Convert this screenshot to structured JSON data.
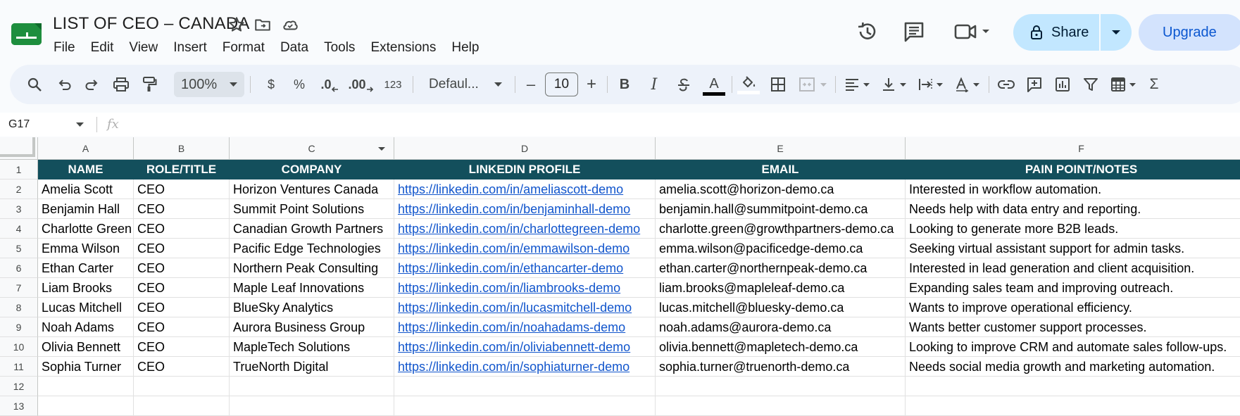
{
  "document": {
    "title": "LIST OF CEO – CANADA"
  },
  "menu": [
    "File",
    "Edit",
    "View",
    "Insert",
    "Format",
    "Data",
    "Tools",
    "Extensions",
    "Help"
  ],
  "header_actions": {
    "share_label": "Share",
    "upgrade_label": "Upgrade"
  },
  "toolbar": {
    "zoom": "100%",
    "currency": "$",
    "percent": "%",
    "decrease_decimal": ".0",
    "increase_decimal": ".00",
    "number_format": "123",
    "font": "Defaul...",
    "font_size": "10",
    "minus": "–",
    "plus": "+",
    "bold": "B",
    "italic": "I",
    "text_color_letter": "A",
    "sum": "Σ"
  },
  "formula_bar": {
    "cell_ref": "G17",
    "fx_label": "fx"
  },
  "columns": [
    "A",
    "B",
    "C",
    "D",
    "E",
    "F"
  ],
  "rows": [
    "1",
    "2",
    "3",
    "4",
    "5",
    "6",
    "7",
    "8",
    "9",
    "10",
    "11",
    "12",
    "13"
  ],
  "headers": [
    "NAME",
    "ROLE/TITLE",
    "COMPANY",
    "LINKEDIN PROFILE",
    "EMAIL",
    "PAIN POINT/NOTES"
  ],
  "records": [
    [
      "Amelia Scott",
      "CEO",
      "Horizon Ventures Canada",
      "https://linkedin.com/in/ameliascott-demo",
      "amelia.scott@horizon-demo.ca",
      "Interested in workflow automation."
    ],
    [
      "Benjamin Hall",
      "CEO",
      "Summit Point Solutions",
      "https://linkedin.com/in/benjaminhall-demo",
      "benjamin.hall@summitpoint-demo.ca",
      "Needs help with data entry and reporting."
    ],
    [
      "Charlotte Green",
      "CEO",
      "Canadian Growth Partners",
      "https://linkedin.com/in/charlottegreen-demo",
      "charlotte.green@growthpartners-demo.ca",
      "Looking to generate more B2B leads."
    ],
    [
      "Emma Wilson",
      "CEO",
      "Pacific Edge Technologies",
      "https://linkedin.com/in/emmawilson-demo",
      "emma.wilson@pacificedge-demo.ca",
      "Seeking virtual assistant support for admin tasks."
    ],
    [
      "Ethan Carter",
      "CEO",
      "Northern Peak Consulting",
      "https://linkedin.com/in/ethancarter-demo",
      "ethan.carter@northernpeak-demo.ca",
      "Interested in lead generation and client acquisition."
    ],
    [
      "Liam Brooks",
      "CEO",
      "Maple Leaf Innovations",
      "https://linkedin.com/in/liambrooks-demo",
      "liam.brooks@mapleleaf-demo.ca",
      "Expanding sales team and improving outreach."
    ],
    [
      "Lucas Mitchell",
      "CEO",
      "BlueSky Analytics",
      "https://linkedin.com/in/lucasmitchell-demo",
      "lucas.mitchell@bluesky-demo.ca",
      "Wants to improve operational efficiency."
    ],
    [
      "Noah Adams",
      "CEO",
      "Aurora Business Group",
      "https://linkedin.com/in/noahadams-demo",
      "noah.adams@aurora-demo.ca",
      "Wants better customer support processes."
    ],
    [
      "Olivia Bennett",
      "CEO",
      "MapleTech Solutions",
      "https://linkedin.com/in/oliviabennett-demo",
      "olivia.bennett@mapletech-demo.ca",
      "Looking to improve CRM and automate sales follow-ups."
    ],
    [
      "Sophia Turner",
      "CEO",
      "TrueNorth Digital",
      "https://linkedin.com/in/sophiaturner-demo",
      "sophia.turner@truenorth-demo.ca",
      "Needs social media growth and marketing automation."
    ]
  ],
  "colors": {
    "header_fill": "#134f5c",
    "link": "#1155cc",
    "share": "#c2e7ff",
    "upgrade": "#d3e3fd"
  }
}
